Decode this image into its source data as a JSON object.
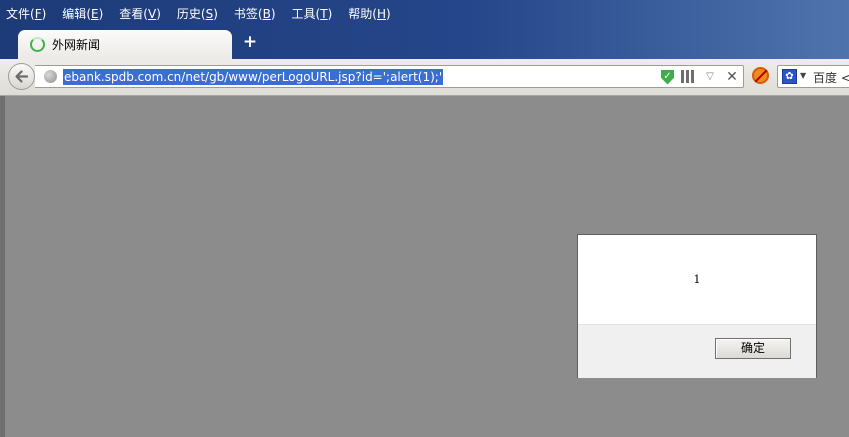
{
  "menu": [
    {
      "label": "文件",
      "key": "F"
    },
    {
      "label": "编辑",
      "key": "E"
    },
    {
      "label": "查看",
      "key": "V"
    },
    {
      "label": "历史",
      "key": "S"
    },
    {
      "label": "书签",
      "key": "B"
    },
    {
      "label": "工具",
      "key": "T"
    },
    {
      "label": "帮助",
      "key": "H"
    }
  ],
  "tab": {
    "title": "外网新闻",
    "new_tab_label": "+"
  },
  "navbar": {
    "url": "ebank.spdb.com.cn/net/gb/www/perLogoURL.jsp?id=';alert(1);'",
    "search_placeholder": "百度 <"
  },
  "dialog": {
    "message": "1",
    "ok_label": "确定"
  },
  "colors": {
    "titlebar": "#25468a",
    "url_selection": "#3a6fd1",
    "page_overlay": "#8c8c8c"
  }
}
